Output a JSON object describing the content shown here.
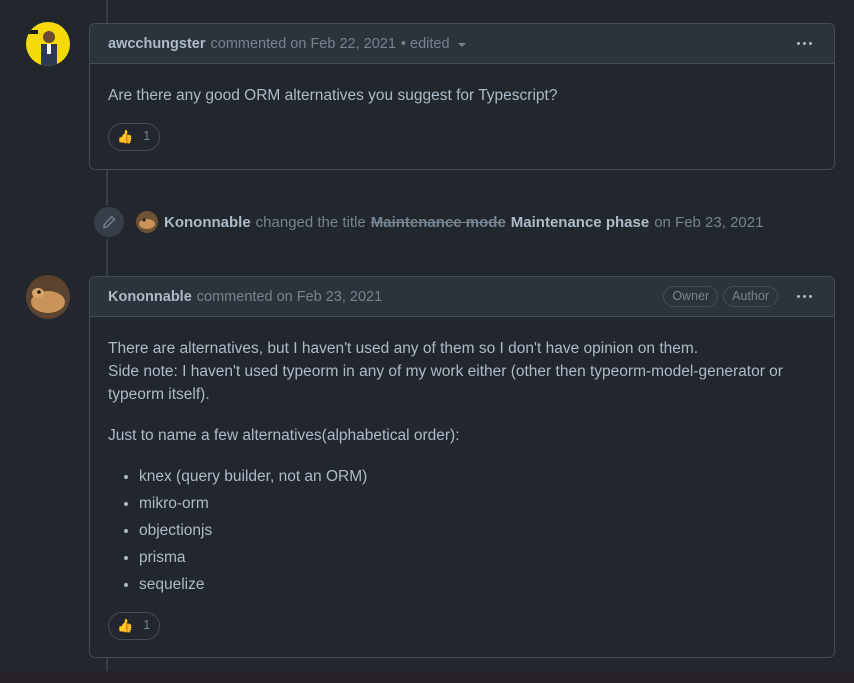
{
  "comment1": {
    "author": "awcchungster",
    "meta": "commented on Feb 22, 2021",
    "edited": "• edited",
    "body": "Are there any good ORM alternatives you suggest for Typescript?",
    "reaction": {
      "emoji": "👍",
      "count": "1"
    }
  },
  "event": {
    "actor": "Kononnable",
    "action": "changed the title",
    "old_title": "Maintenance mode",
    "new_title": "Maintenance phase",
    "date": "on Feb 23, 2021"
  },
  "comment2": {
    "author": "Kononnable",
    "meta": "commented on Feb 23, 2021",
    "badges": [
      "Owner",
      "Author"
    ],
    "para1_line1": "There are alternatives, but I haven't used any of them so I don't have opinion on them.",
    "para1_line2": "Side note: I haven't used typeorm in any of my work either (other then typeorm-model-generator or typeorm itself).",
    "para2": "Just to name a few alternatives(alphabetical order):",
    "list": [
      "knex (query builder, not an ORM)",
      "mikro-orm",
      "objectionjs",
      "prisma",
      "sequelize"
    ],
    "reaction": {
      "emoji": "👍",
      "count": "1"
    }
  }
}
